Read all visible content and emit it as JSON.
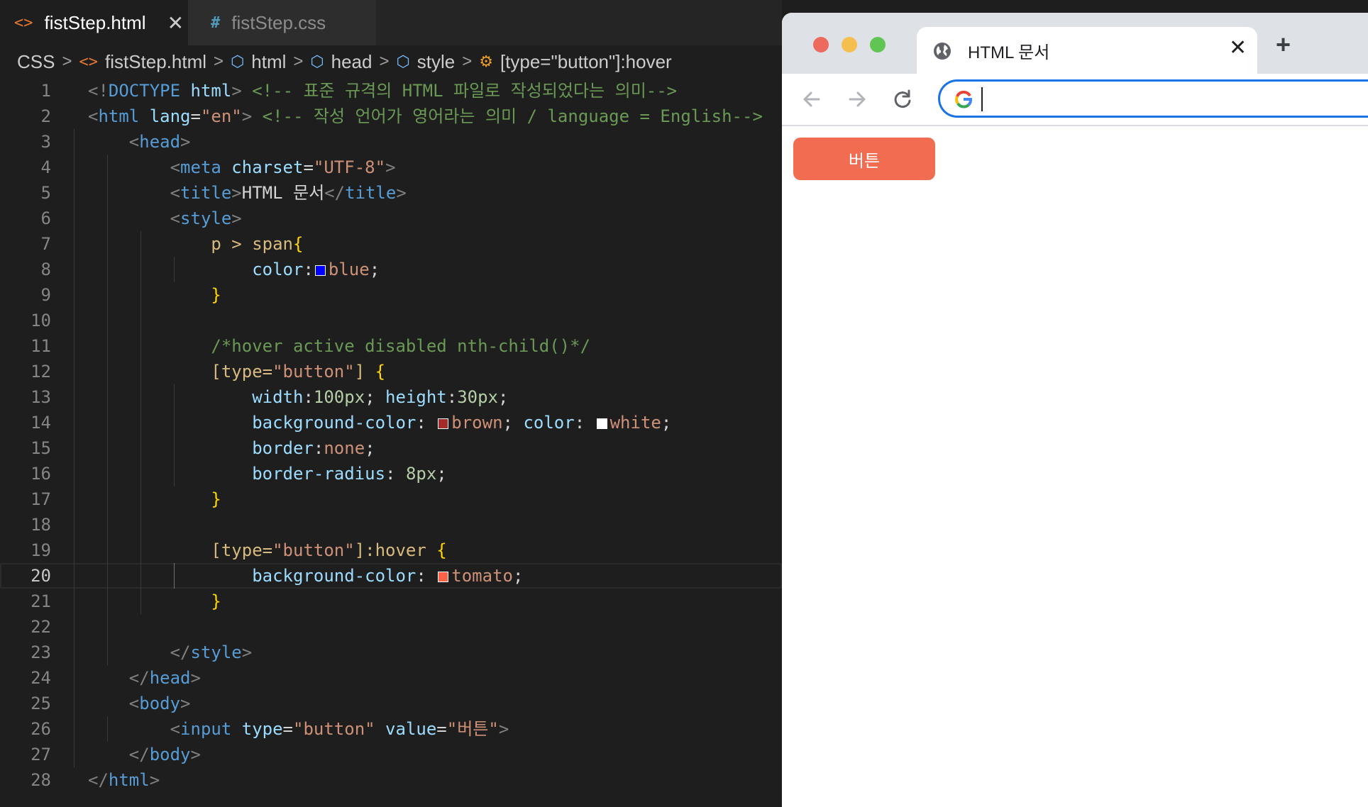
{
  "editor": {
    "tabs": [
      {
        "label": "fistStep.html",
        "icon": "html-file-icon",
        "active": true
      },
      {
        "label": "fistStep.css",
        "icon": "css-file-icon",
        "active": false
      }
    ],
    "breadcrumb": [
      "CSS",
      "fistStep.html",
      "html",
      "head",
      "style",
      "[type=\"button\"]:hover"
    ],
    "current_line": 20,
    "lines": [
      [
        [
          "<!",
          "brk"
        ],
        [
          "DOCTYPE",
          "tag"
        ],
        [
          " ",
          "txt"
        ],
        [
          "html",
          "attr"
        ],
        [
          ">",
          "brk"
        ],
        [
          " <!-- 표준 규격의 HTML 파일로 작성되었다는 의미-->",
          "cmt"
        ]
      ],
      [
        [
          "<",
          "brk"
        ],
        [
          "html",
          "tag"
        ],
        [
          " ",
          "txt"
        ],
        [
          "lang",
          "attr"
        ],
        [
          "=",
          "txt"
        ],
        [
          "\"en\"",
          "str"
        ],
        [
          ">",
          "brk"
        ],
        [
          " <!-- 작성 언어가 영어라는 의미 / language = English-->",
          "cmt"
        ]
      ],
      [
        [
          "    ",
          "txt"
        ],
        [
          "<",
          "brk"
        ],
        [
          "head",
          "tag"
        ],
        [
          ">",
          "brk"
        ]
      ],
      [
        [
          "        ",
          "txt"
        ],
        [
          "<",
          "brk"
        ],
        [
          "meta",
          "tag"
        ],
        [
          " ",
          "txt"
        ],
        [
          "charset",
          "attr"
        ],
        [
          "=",
          "txt"
        ],
        [
          "\"UTF-8\"",
          "str"
        ],
        [
          ">",
          "brk"
        ]
      ],
      [
        [
          "        ",
          "txt"
        ],
        [
          "<",
          "brk"
        ],
        [
          "title",
          "tag"
        ],
        [
          ">",
          "brk"
        ],
        [
          "HTML 문서",
          "txt"
        ],
        [
          "</",
          "brk"
        ],
        [
          "title",
          "tag"
        ],
        [
          ">",
          "brk"
        ]
      ],
      [
        [
          "        ",
          "txt"
        ],
        [
          "<",
          "brk"
        ],
        [
          "style",
          "tag"
        ],
        [
          ">",
          "brk"
        ]
      ],
      [
        [
          "            ",
          "txt"
        ],
        [
          "p > span",
          "sel"
        ],
        [
          "{",
          "brace"
        ]
      ],
      [
        [
          "                ",
          "txt"
        ],
        [
          "color",
          "prop"
        ],
        [
          ":",
          "txt"
        ],
        [
          "#0000ff",
          "swatch"
        ],
        [
          "blue",
          "val"
        ],
        [
          ";",
          "txt"
        ]
      ],
      [
        [
          "            ",
          "txt"
        ],
        [
          "}",
          "brace"
        ]
      ],
      [],
      [
        [
          "            ",
          "txt"
        ],
        [
          "/*hover active disabled nth-child()*/",
          "cmt"
        ]
      ],
      [
        [
          "            ",
          "txt"
        ],
        [
          "[type=",
          "sel"
        ],
        [
          "\"button\"",
          "str"
        ],
        [
          "]",
          "sel"
        ],
        [
          " ",
          "txt"
        ],
        [
          "{",
          "brace"
        ]
      ],
      [
        [
          "                ",
          "txt"
        ],
        [
          "width",
          "prop"
        ],
        [
          ":",
          "txt"
        ],
        [
          "100px",
          "num"
        ],
        [
          "; ",
          "txt"
        ],
        [
          "height",
          "prop"
        ],
        [
          ":",
          "txt"
        ],
        [
          "30px",
          "num"
        ],
        [
          ";",
          "txt"
        ]
      ],
      [
        [
          "                ",
          "txt"
        ],
        [
          "background-color",
          "prop"
        ],
        [
          ": ",
          "txt"
        ],
        [
          "#a52a2a",
          "swatch"
        ],
        [
          "brown",
          "val"
        ],
        [
          "; ",
          "txt"
        ],
        [
          "color",
          "prop"
        ],
        [
          ": ",
          "txt"
        ],
        [
          "#ffffff",
          "swatch"
        ],
        [
          "white",
          "val"
        ],
        [
          ";",
          "txt"
        ]
      ],
      [
        [
          "                ",
          "txt"
        ],
        [
          "border",
          "prop"
        ],
        [
          ":",
          "txt"
        ],
        [
          "none",
          "val"
        ],
        [
          ";",
          "txt"
        ]
      ],
      [
        [
          "                ",
          "txt"
        ],
        [
          "border-radius",
          "prop"
        ],
        [
          ": ",
          "txt"
        ],
        [
          "8px",
          "num"
        ],
        [
          ";",
          "txt"
        ]
      ],
      [
        [
          "            ",
          "txt"
        ],
        [
          "}",
          "brace"
        ]
      ],
      [],
      [
        [
          "            ",
          "txt"
        ],
        [
          "[type=",
          "sel"
        ],
        [
          "\"button\"",
          "str"
        ],
        [
          "]:hover",
          "sel"
        ],
        [
          " ",
          "txt"
        ],
        [
          "{",
          "brace"
        ]
      ],
      [
        [
          "                ",
          "txt"
        ],
        [
          "background-color",
          "prop"
        ],
        [
          ": ",
          "txt"
        ],
        [
          "#ff6347",
          "swatch"
        ],
        [
          "tomato",
          "val"
        ],
        [
          ";",
          "txt"
        ]
      ],
      [
        [
          "            ",
          "txt"
        ],
        [
          "}",
          "brace"
        ]
      ],
      [],
      [
        [
          "        ",
          "txt"
        ],
        [
          "</",
          "brk"
        ],
        [
          "style",
          "tag"
        ],
        [
          ">",
          "brk"
        ]
      ],
      [
        [
          "    ",
          "txt"
        ],
        [
          "</",
          "brk"
        ],
        [
          "head",
          "tag"
        ],
        [
          ">",
          "brk"
        ]
      ],
      [
        [
          "    ",
          "txt"
        ],
        [
          "<",
          "brk"
        ],
        [
          "body",
          "tag"
        ],
        [
          ">",
          "brk"
        ]
      ],
      [
        [
          "        ",
          "txt"
        ],
        [
          "<",
          "brk"
        ],
        [
          "input",
          "tag"
        ],
        [
          " ",
          "txt"
        ],
        [
          "type",
          "attr"
        ],
        [
          "=",
          "txt"
        ],
        [
          "\"button\"",
          "str"
        ],
        [
          " ",
          "txt"
        ],
        [
          "value",
          "attr"
        ],
        [
          "=",
          "txt"
        ],
        [
          "\"버튼\"",
          "str"
        ],
        [
          ">",
          "brk"
        ]
      ],
      [
        [
          "    ",
          "txt"
        ],
        [
          "</",
          "brk"
        ],
        [
          "body",
          "tag"
        ],
        [
          ">",
          "brk"
        ]
      ],
      [
        [
          "</",
          "brk"
        ],
        [
          "html",
          "tag"
        ],
        [
          ">",
          "brk"
        ]
      ]
    ]
  },
  "browser": {
    "tab_title": "HTML 문서",
    "tab_icon": "globe-icon",
    "omnibox_value": "",
    "page": {
      "button_label": "버튼",
      "button_color": "#f16c50"
    }
  }
}
